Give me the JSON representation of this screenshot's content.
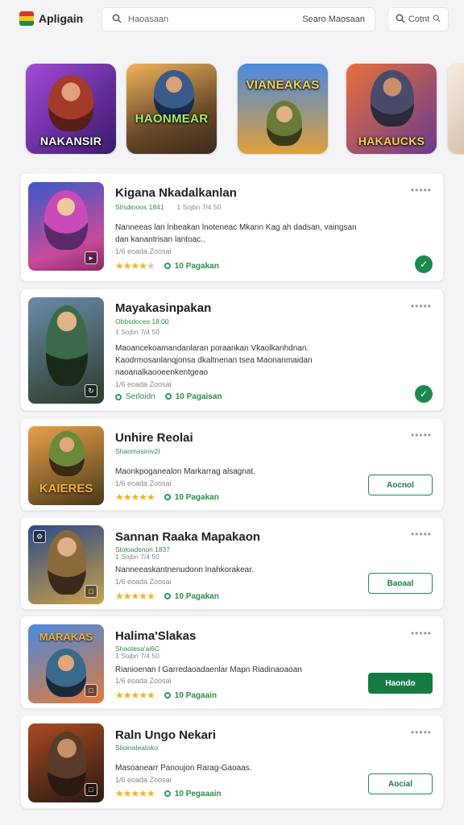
{
  "header": {
    "app_name": "Apligain",
    "search_placeholder": "Haoasaan",
    "search_button": "Searo Maosaan",
    "user_label": "Cotnt"
  },
  "carousel": [
    {
      "label": "NAKANSIR",
      "colors": [
        "#8b3fc4",
        "#3a1a6e"
      ]
    },
    {
      "label": "HAONMEAR",
      "colors": [
        "#e0a24a",
        "#5a3a22"
      ]
    },
    {
      "label": "VIANEAKAS",
      "colors": [
        "#3a7fd8",
        "#e8a23a"
      ]
    },
    {
      "label": "HAKAUCKS",
      "colors": [
        "#d35a2a",
        "#6a3a8e"
      ]
    },
    {
      "label": "",
      "colors": [
        "#f0e6d8",
        "#b08a6a"
      ]
    }
  ],
  "apps": [
    {
      "title": "Kigana Nkadalkanlan",
      "meta": "Sl/sdinoos 1841",
      "meta2": "1 Sojbn 7/4 50",
      "description": "Nanneeas lan lnbeakan lnoteneac Mkann Kag ah dadsan, vaingsan dan kanantrisan lantoac..",
      "sub": "1/6 eoada Zoosai",
      "stars": 4,
      "dev_label": "10 Pagakan",
      "action": "check",
      "thumb_colors": [
        "#3a59c8",
        "#c84a9a"
      ]
    },
    {
      "title": "Mayakasinpakan",
      "meta": "Obbsdoces 18:00",
      "meta2": "1 Sojbn 7/4 50",
      "description": "Maoancekoamandanlaran poraankan Vkaolkanhdnan. Kaodrmosanlanqjonsa dkaltnenan tsea Maonanmaidan naoanalkaooeenkentgeao",
      "sub": "1/6 eoada Zoosai",
      "stars": 0,
      "dev_prefix": "Serloidn",
      "dev_label": "10 Pagaisan",
      "action": "check",
      "thumb_colors": [
        "#4b6a88",
        "#2c3d2c"
      ]
    },
    {
      "title": "Unhire Reolai",
      "meta": "Shaomasiniv2I",
      "description": "Maonkpoganealon Markarrag alsagnat.",
      "sub": "1/6 eoada Zoosai",
      "stars": 5,
      "dev_label": "10 Pagakan",
      "action": "Aocnol",
      "action_style": "outline",
      "thumb_colors": [
        "#c87a2a",
        "#4a3a1a"
      ]
    },
    {
      "title": "Sannan Raaka Mapakaon",
      "meta": "Sloloadsnon 1837",
      "meta2": "1 Sojbn 7/4 50",
      "description": "Nanneeaskantnenudonn lnahkorakear.",
      "sub": "1/6 eoada Zoosai",
      "stars": 5,
      "dev_label": "10 Pagakan",
      "action": "Baoaal",
      "action_style": "outline",
      "thumb_colors": [
        "#2c4a8a",
        "#c8a04a"
      ]
    },
    {
      "title": "Halima'Slakas",
      "meta": "Shaotesa'ai6C",
      "meta2": "1 Sojbn 7/4 50",
      "description": "Rianioenan l Garredaoadaenlar Mapn Riadinaoaoan",
      "sub": "1/6 eoada Zoosai",
      "stars": 5,
      "dev_label": "10 Pagaain",
      "action": "Haondo",
      "action_style": "filled",
      "thumb_colors": [
        "#3a7ad8",
        "#d86a3a"
      ]
    },
    {
      "title": "Raln Ungo Nekari",
      "meta": "Slioinaleatoko",
      "description": "Masoanearr Panoujon Rarag-Gaoaas.",
      "sub": "1/6 eoada Zoosai",
      "stars": 5,
      "dev_label": "10 Pegaaain",
      "action": "Aocial",
      "action_style": "outline",
      "thumb_colors": [
        "#8a3a1a",
        "#2a1a12"
      ]
    }
  ],
  "colors": {
    "accent": "#147c42",
    "star": "#f2b01e",
    "background": "#f4f4f6"
  }
}
